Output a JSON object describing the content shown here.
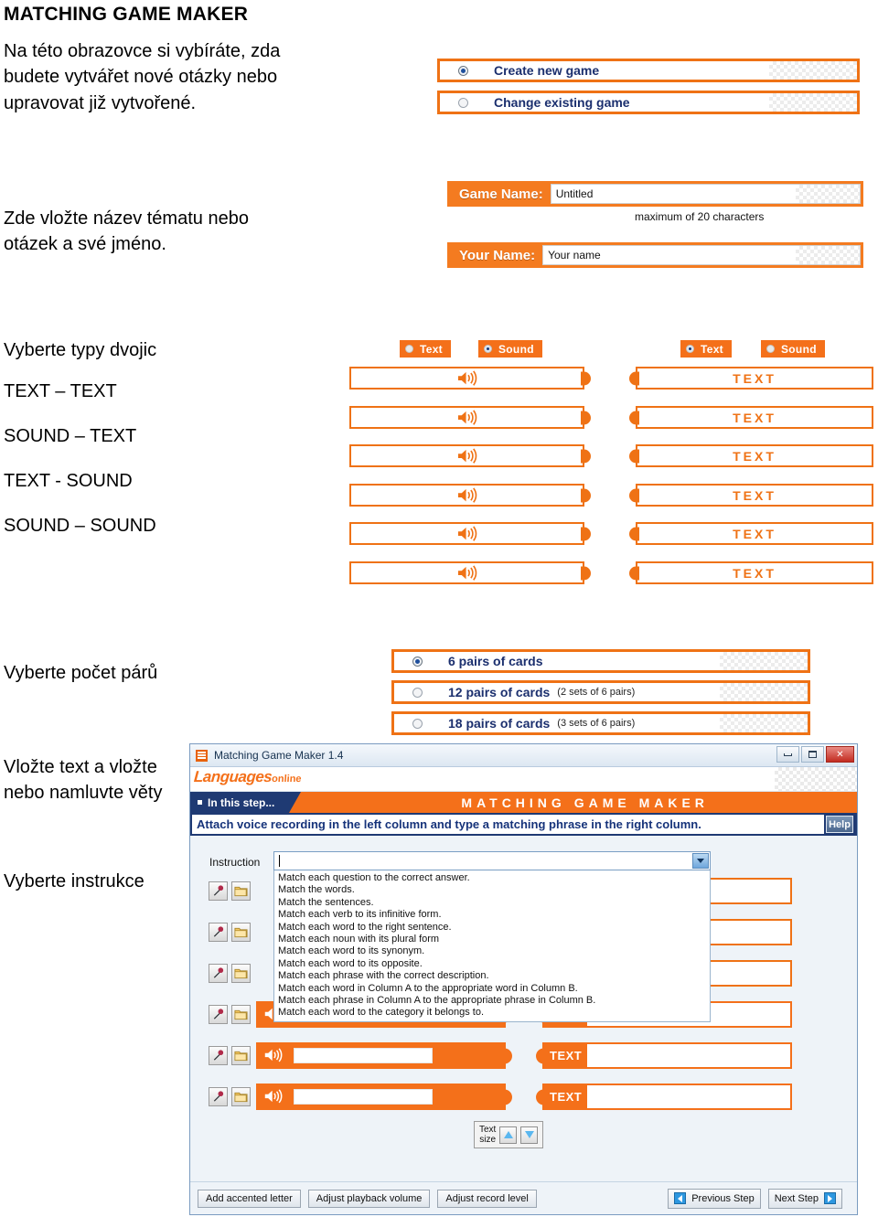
{
  "page_title": "MATCHING GAME MAKER",
  "czech": {
    "intro": "Na této obrazovce si vybíráte, zda budete vytvářet nové otázky nebo upravovat již vytvořené.",
    "name_hint": "Zde vložte název tématu nebo otázek a své jméno.",
    "pairs_count": "Vyberte počet párů",
    "insert_text": "Vložte text a vložte nebo namluvte věty",
    "choose_instruction": "Vyberte instrukce",
    "pair_types_lead": "Vyberte typy dvojic",
    "pair_types": [
      "TEXT – TEXT",
      "SOUND – TEXT",
      "TEXT - SOUND",
      "SOUND – SOUND"
    ]
  },
  "mode_choice": {
    "options": [
      {
        "label": "Create new game",
        "selected": true
      },
      {
        "label": "Change existing game",
        "selected": false
      }
    ]
  },
  "name_fields": {
    "game_name_label": "Game Name:",
    "game_name_value": "Untitled",
    "max_chars_note": "maximum of 20 characters",
    "your_name_label": "Your Name:",
    "your_name_value": "Your name"
  },
  "pair_type_selector": {
    "left": {
      "text_label": "Text",
      "sound_label": "Sound",
      "selected": "Sound"
    },
    "right": {
      "text_label": "Text",
      "sound_label": "Sound",
      "selected": "Text"
    },
    "row_count": 6,
    "right_row_label": "TEXT"
  },
  "card_pairs": {
    "options": [
      {
        "label": "6 pairs of cards",
        "note": "",
        "selected": true
      },
      {
        "label": "12 pairs of cards",
        "note": "(2 sets of 6 pairs)",
        "selected": false
      },
      {
        "label": "18 pairs of cards",
        "note": "(3 sets of 6 pairs)",
        "selected": false
      }
    ]
  },
  "app": {
    "window_title": "Matching Game Maker 1.4",
    "logo_main": "Languages",
    "logo_sub": "online",
    "step_tab": "In this step...",
    "banner_title": "MATCHING GAME MAKER",
    "instruction_text": "Attach voice recording in the left column and type a matching phrase in the right column.",
    "help_label": "Help",
    "instruction_field_label": "Instruction",
    "instruction_value": "",
    "dropdown_options": [
      "Match each question to the correct answer.",
      "Match the words.",
      "Match the sentences.",
      "Match each verb to its infinitive form.",
      "Match each word to the right sentence.",
      "Match each noun with its plural form",
      "Match each word to its synonym.",
      "Match each word to its opposite.",
      "Match each phrase with the correct description.",
      "Match each word in Column A to the appropriate word in Column B.",
      "Match each phrase in Column A to the appropriate phrase in Column B.",
      "Match each word to the category it belongs to."
    ],
    "row_text_label": "TEXT",
    "text_size_label_line1": "Text",
    "text_size_label_line2": "size",
    "footer_buttons": [
      "Add accented letter",
      "Adjust playback volume",
      "Adjust record level"
    ],
    "previous_step": "Previous Step",
    "next_step": "Next Step"
  },
  "colors": {
    "orange": "#f4701a",
    "orange_border": "#ef7215",
    "navy": "#1f3a73",
    "label_navy": "#1b2f6e"
  }
}
